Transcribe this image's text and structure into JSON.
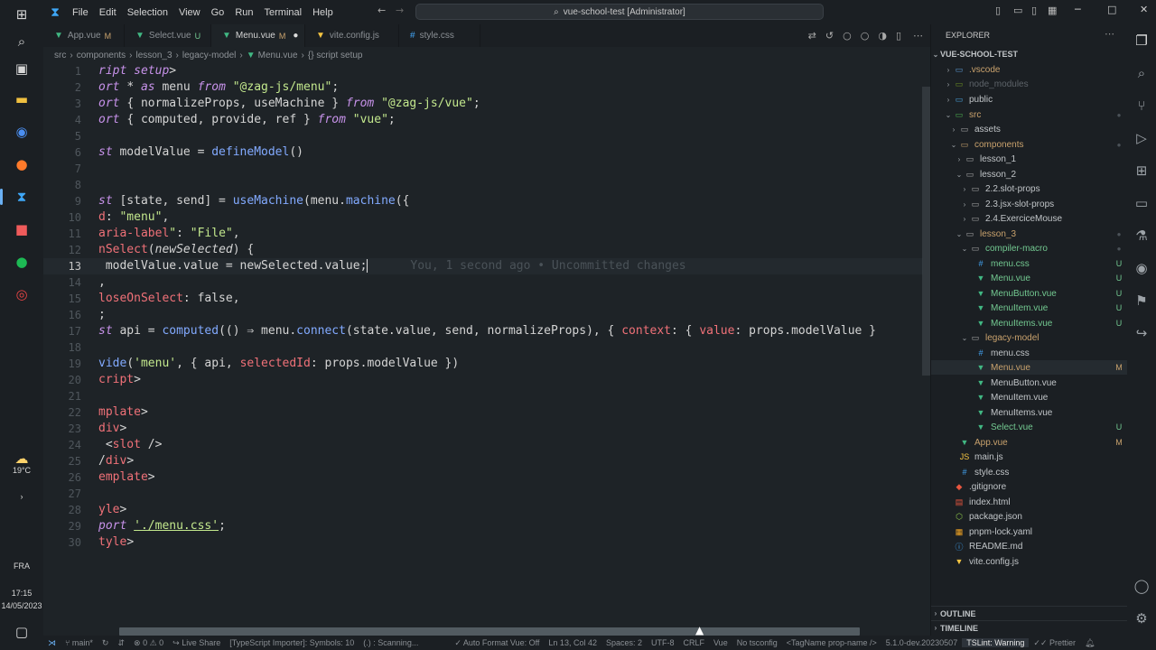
{
  "window": {
    "title": "vue-school-test [Administrator]",
    "menus": [
      "File",
      "Edit",
      "Selection",
      "View",
      "Go",
      "Run",
      "Terminal",
      "Help"
    ]
  },
  "taskbar": {
    "weather_temp": "19°C",
    "language": "FRA",
    "time": "17:15",
    "date": "14/05/2023"
  },
  "tabs": [
    {
      "label": "App.vue",
      "status": "M"
    },
    {
      "label": "Select.vue",
      "status": "U"
    },
    {
      "label": "Menu.vue",
      "status": "M"
    },
    {
      "label": "vite.config.js",
      "status": ""
    },
    {
      "label": "style.css",
      "status": ""
    }
  ],
  "breadcrumb": [
    "src",
    "components",
    "lesson_3",
    "legacy-model",
    "Menu.vue",
    "{} script setup"
  ],
  "editor": {
    "line_numbers": [
      "1",
      "2",
      "3",
      "4",
      "5",
      "6",
      "7",
      "8",
      "9",
      "10",
      "11",
      "12",
      "13",
      "14",
      "15",
      "16",
      "17",
      "18",
      "19",
      "20",
      "21",
      "22",
      "23",
      "24",
      "25",
      "26",
      "27",
      "28",
      "29",
      "30"
    ],
    "blame": "You, 1 second ago • Uncommitted changes"
  },
  "explorer": {
    "title": "EXPLORER",
    "project": "VUE-SCHOOL-TEST",
    "items": [
      {
        "label": ".vscode",
        "badge": ""
      },
      {
        "label": "node_modules",
        "badge": ""
      },
      {
        "label": "public",
        "badge": ""
      },
      {
        "label": "src",
        "badge": ""
      },
      {
        "label": "assets",
        "badge": ""
      },
      {
        "label": "components",
        "badge": ""
      },
      {
        "label": "lesson_1",
        "badge": ""
      },
      {
        "label": "lesson_2",
        "badge": ""
      },
      {
        "label": "2.2.slot-props",
        "badge": ""
      },
      {
        "label": "2.3.jsx-slot-props",
        "badge": ""
      },
      {
        "label": "2.4.ExerciceMouse",
        "badge": ""
      },
      {
        "label": "lesson_3",
        "badge": ""
      },
      {
        "label": "compiler-macro",
        "badge": ""
      },
      {
        "label": "menu.css",
        "badge": "U"
      },
      {
        "label": "Menu.vue",
        "badge": "U"
      },
      {
        "label": "MenuButton.vue",
        "badge": "U"
      },
      {
        "label": "MenuItem.vue",
        "badge": "U"
      },
      {
        "label": "MenuItems.vue",
        "badge": "U"
      },
      {
        "label": "legacy-model",
        "badge": ""
      },
      {
        "label": "menu.css",
        "badge": ""
      },
      {
        "label": "Menu.vue",
        "badge": "M"
      },
      {
        "label": "MenuButton.vue",
        "badge": ""
      },
      {
        "label": "MenuItem.vue",
        "badge": ""
      },
      {
        "label": "MenuItems.vue",
        "badge": ""
      },
      {
        "label": "Select.vue",
        "badge": "U"
      },
      {
        "label": "App.vue",
        "badge": "M"
      },
      {
        "label": "main.js",
        "badge": ""
      },
      {
        "label": "style.css",
        "badge": ""
      },
      {
        "label": ".gitignore",
        "badge": ""
      },
      {
        "label": "index.html",
        "badge": ""
      },
      {
        "label": "package.json",
        "badge": ""
      },
      {
        "label": "pnpm-lock.yaml",
        "badge": ""
      },
      {
        "label": "README.md",
        "badge": ""
      },
      {
        "label": "vite.config.js",
        "badge": ""
      }
    ],
    "outline": "OUTLINE",
    "timeline": "TIMELINE"
  },
  "statusbar": {
    "branch": "main*",
    "problems": "0 ⚠ 0",
    "live_share": "Live Share",
    "ts_importer": "[TypeScript Importer]: Symbols: 10",
    "scanning": "(.) : Scanning...",
    "auto_format": "Auto Format Vue: Off",
    "position": "Ln 13, Col 42",
    "spaces": "Spaces: 2",
    "encoding": "UTF-8",
    "eol": "CRLF",
    "language": "Vue",
    "tsconfig": "No tsconfig",
    "tag": "<TagName prop-name />",
    "version": "5.1.0-dev.20230507",
    "tslint": "TSLint: Warning",
    "prettier": "Prettier"
  },
  "colors": {
    "vue_green": "#41b883",
    "keyword": "#c792ea",
    "string": "#c3e88d",
    "function": "#82aaff"
  }
}
